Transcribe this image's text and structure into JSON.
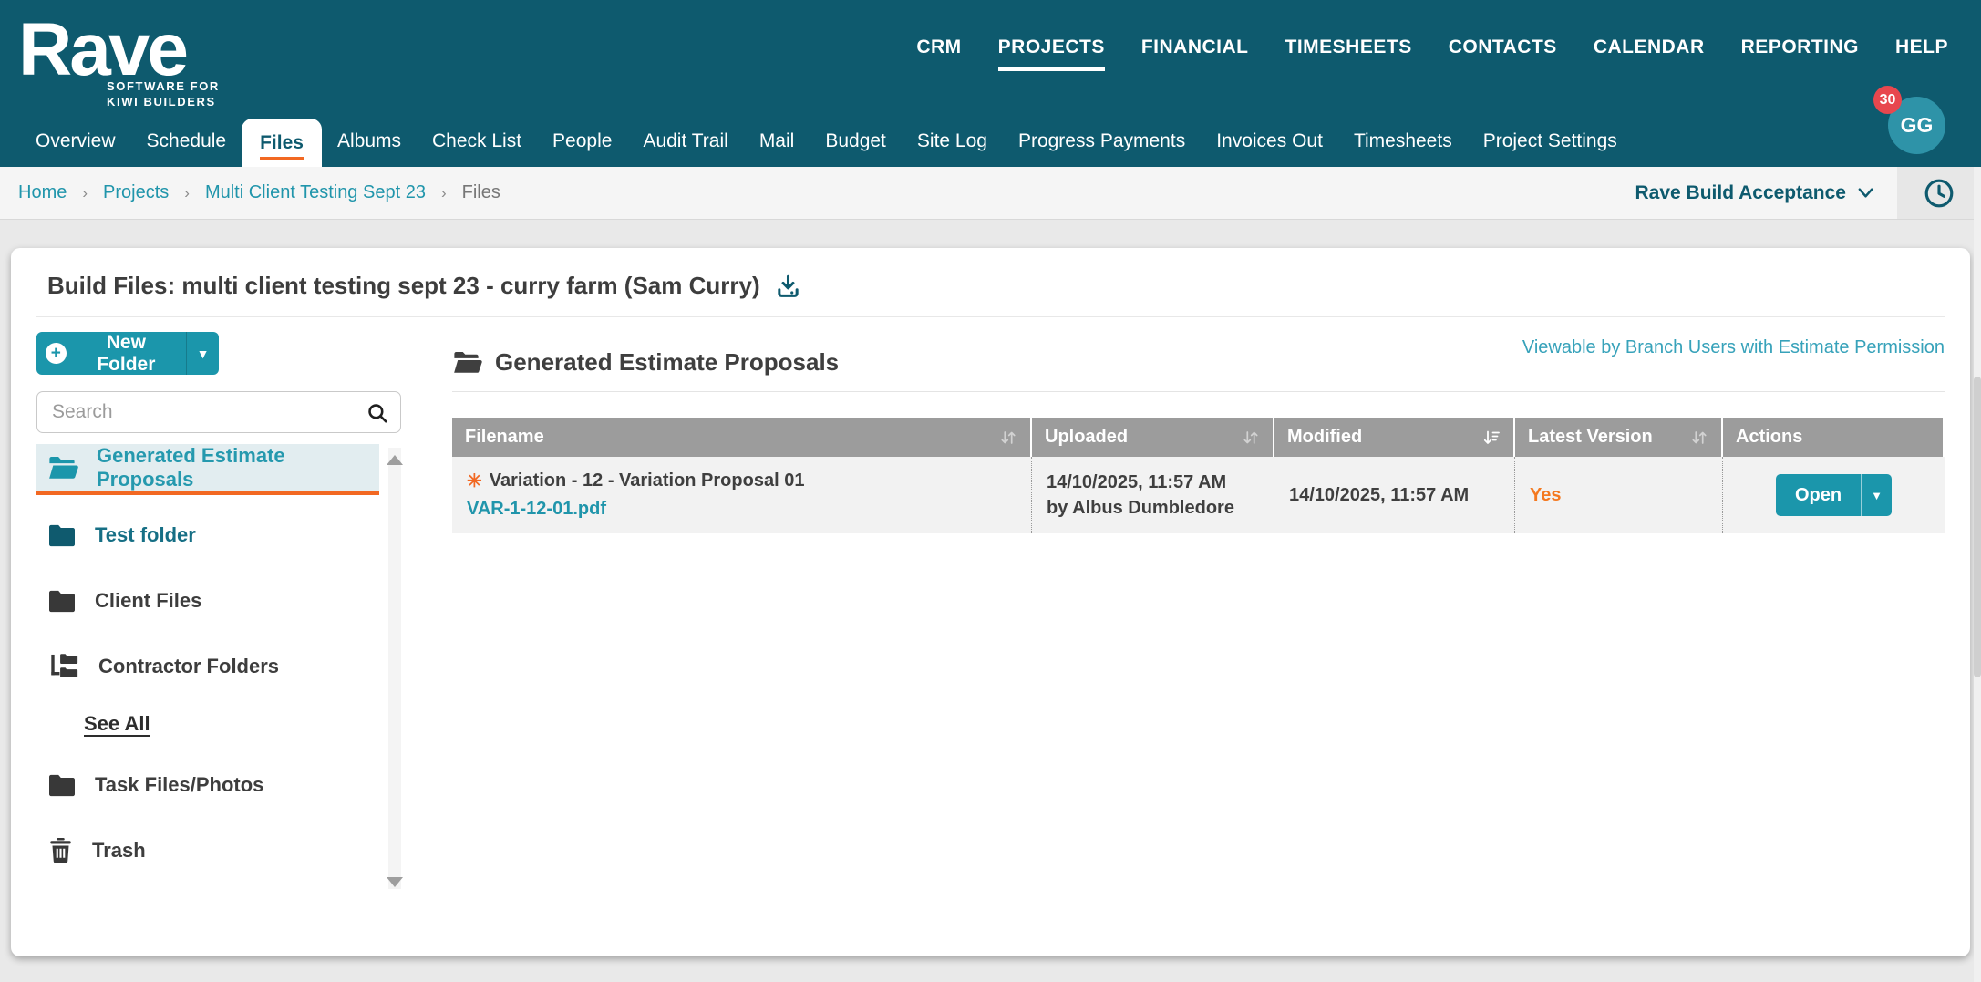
{
  "colors": {
    "header_teal": "#0e5a6e",
    "accent_teal": "#1b96ab",
    "avatar_teal": "#2e93a8",
    "link_teal": "#2095ab",
    "selected_bg": "#e2edf0",
    "orange": "#f26822",
    "orange_text": "#f47920",
    "badge_red": "#e8474e",
    "table_header_bg": "#9c9c9c",
    "row_bg": "#f2f2f2",
    "page_bg": "#e9e9e9",
    "breadcrumb_bg": "#f5f5f5",
    "text_dark": "#3f3f3f"
  },
  "icons": {
    "star": "✳",
    "caret_down": "▼"
  },
  "brand": {
    "name": "Rave",
    "tagline1": "SOFTWARE FOR",
    "tagline2": "KIWI BUILDERS"
  },
  "top_nav": {
    "items": [
      {
        "label": "CRM"
      },
      {
        "label": "PROJECTS",
        "active": true
      },
      {
        "label": "FINANCIAL"
      },
      {
        "label": "TIMESHEETS"
      },
      {
        "label": "CONTACTS"
      },
      {
        "label": "CALENDAR"
      },
      {
        "label": "REPORTING"
      },
      {
        "label": "HELP"
      }
    ]
  },
  "user": {
    "initials": "GG",
    "notification_count": "30"
  },
  "project_tabs": {
    "items": [
      {
        "label": "Overview"
      },
      {
        "label": "Schedule"
      },
      {
        "label": "Files",
        "active": true
      },
      {
        "label": "Albums"
      },
      {
        "label": "Check List"
      },
      {
        "label": "People"
      },
      {
        "label": "Audit Trail"
      },
      {
        "label": "Mail"
      },
      {
        "label": "Budget"
      },
      {
        "label": "Site Log"
      },
      {
        "label": "Progress Payments"
      },
      {
        "label": "Invoices Out"
      },
      {
        "label": "Timesheets"
      },
      {
        "label": "Project Settings"
      }
    ]
  },
  "breadcrumb": {
    "separator": "›",
    "items": [
      {
        "label": "Home",
        "link": true
      },
      {
        "label": "Projects",
        "link": true
      },
      {
        "label": "Multi Client Testing Sept 23",
        "link": true
      },
      {
        "label": "Files",
        "link": false
      }
    ]
  },
  "context_bar": {
    "workflow_label": "Rave Build Acceptance"
  },
  "page": {
    "title": "Build Files: multi client testing sept 23 - curry farm (Sam Curry)"
  },
  "sidebar": {
    "new_folder_label": "New Folder",
    "search_placeholder": "Search",
    "folders": [
      {
        "label": "Generated Estimate Proposals",
        "icon": "folder-open",
        "selected": true
      },
      {
        "label": "Test folder",
        "icon": "folder"
      },
      {
        "label": "Client Files",
        "icon": "folder"
      },
      {
        "label": "Contractor Folders",
        "icon": "folder-tree"
      },
      {
        "label": "See All",
        "type": "link"
      },
      {
        "label": "Task Files/Photos",
        "icon": "folder"
      },
      {
        "label": "Trash",
        "icon": "trash"
      }
    ]
  },
  "main": {
    "heading": "Generated Estimate Proposals",
    "permission_note": "Viewable by Branch Users with Estimate Permission",
    "table": {
      "columns": [
        {
          "label": "Filename",
          "sortable": true
        },
        {
          "label": "Uploaded",
          "sortable": true
        },
        {
          "label": "Modified",
          "sortable": true,
          "sorted": "desc"
        },
        {
          "label": "Latest Version",
          "sortable": true
        },
        {
          "label": "Actions",
          "sortable": false
        }
      ],
      "rows": [
        {
          "title": "Variation - 12 - Variation Proposal 01",
          "file_link": "VAR-1-12-01.pdf",
          "uploaded_date": "14/10/2025, 11:57 AM",
          "uploaded_by": "by Albus Dumbledore",
          "modified_date": "14/10/2025, 11:57 AM",
          "latest_version": "Yes",
          "action_label": "Open"
        }
      ]
    }
  }
}
